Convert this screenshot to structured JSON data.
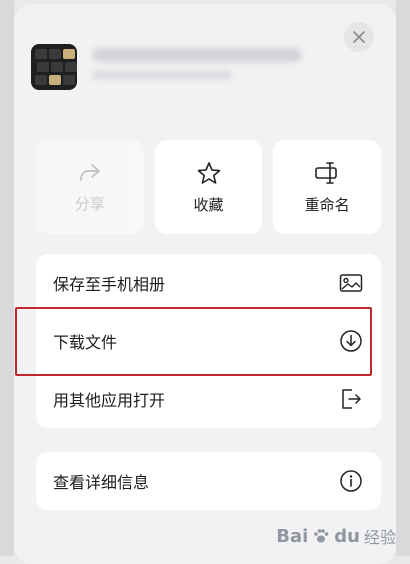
{
  "actions": {
    "share": "分享",
    "favorite": "收藏",
    "rename": "重命名"
  },
  "menu": {
    "save_to_album": "保存至手机相册",
    "download_file": "下载文件",
    "open_with_other_app": "用其他应用打开",
    "view_details": "查看详细信息"
  },
  "watermark": {
    "brand": "Bai",
    "brand_suffix": "du",
    "sub": "经验"
  },
  "colors": {
    "highlight_box": "#c0272d",
    "sheet_bg": "#f2f2f4",
    "card_bg": "#ffffff"
  }
}
